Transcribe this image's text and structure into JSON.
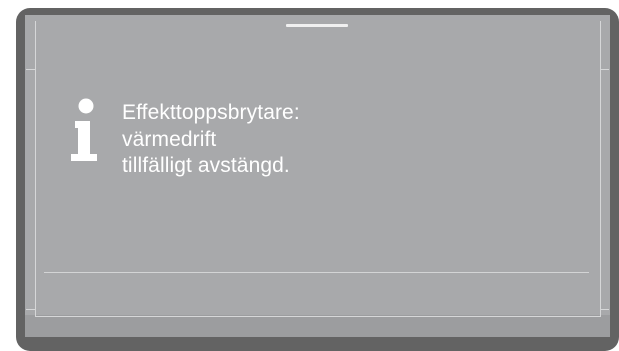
{
  "dialog": {
    "icon": "info-icon",
    "message_lines": [
      "Effekttoppsbrytare:",
      "värmedrift",
      "tillfälligt avstängd."
    ]
  },
  "colors": {
    "bezel": "#636363",
    "screen": "#a8a9ab",
    "text": "#ffffff"
  }
}
